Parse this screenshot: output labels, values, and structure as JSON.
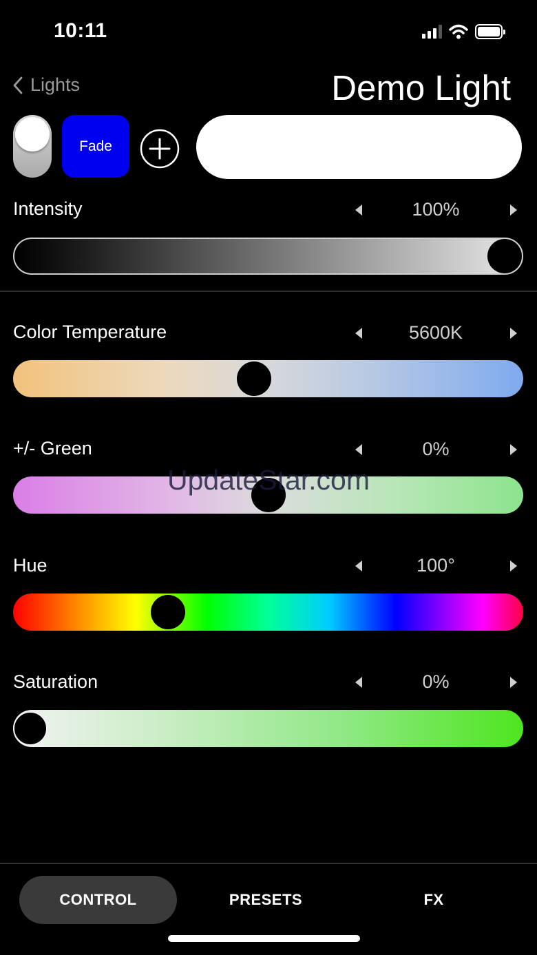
{
  "status_bar": {
    "time": "10:11",
    "signal_bars_filled": 3,
    "signal_bars_total": 4,
    "battery_level": 1.0
  },
  "nav": {
    "back_label": "Lights",
    "title": "Demo Light"
  },
  "controls": {
    "fade_label": "Fade",
    "power_on": true
  },
  "colors": {
    "accent_blue": "#0000f0",
    "background": "#000000",
    "preview_color": "#ffffff",
    "tab_active_bg": "#3a3a3a"
  },
  "sliders": {
    "intensity": {
      "label": "Intensity",
      "value": "100%",
      "position": 1.0
    },
    "temperature": {
      "label": "Color Temperature",
      "value": "5600K",
      "position": 0.47
    },
    "green": {
      "label": "+/- Green",
      "value": "0%",
      "position": 0.5
    },
    "hue": {
      "label": "Hue",
      "value": "100°",
      "position": 0.29
    },
    "saturation": {
      "label": "Saturation",
      "value": "0%",
      "position": 0.0
    }
  },
  "watermark": "UpdateStar.com",
  "tabs": [
    {
      "label": "CONTROL",
      "active": true
    },
    {
      "label": "PRESETS",
      "active": false
    },
    {
      "label": "FX",
      "active": false
    }
  ],
  "icons": [
    "chevron-left-icon",
    "plus-circle-icon",
    "arrow-left-icon",
    "arrow-right-icon",
    "signal-icon",
    "wifi-icon",
    "battery-icon"
  ]
}
